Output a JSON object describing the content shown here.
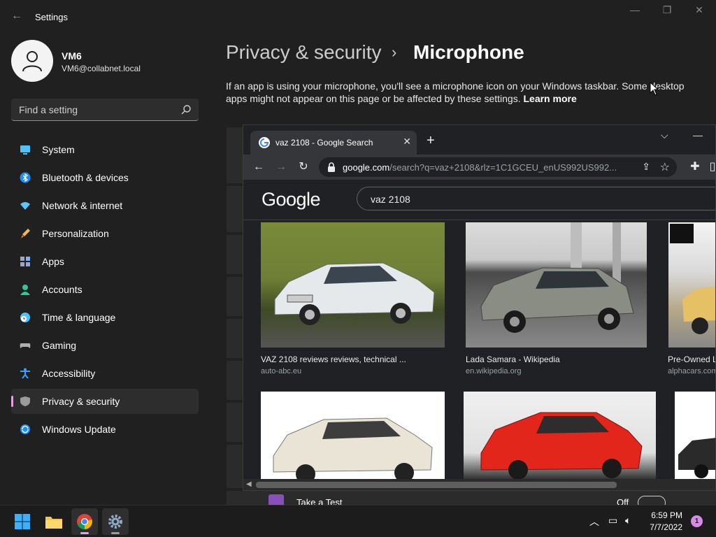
{
  "settings_window": {
    "title": "Settings",
    "user": {
      "name": "VM6",
      "email": "VM6@collabnet.local"
    },
    "search_placeholder": "Find a setting",
    "nav": [
      {
        "label": "System",
        "icon": "monitor-icon",
        "color": "#4cc2ff"
      },
      {
        "label": "Bluetooth & devices",
        "icon": "bluetooth-icon",
        "color": "#1f8ff0"
      },
      {
        "label": "Network & internet",
        "icon": "wifi-icon",
        "color": "#5ec6ff"
      },
      {
        "label": "Personalization",
        "icon": "brush-icon",
        "color": "#f7a34b"
      },
      {
        "label": "Apps",
        "icon": "apps-icon",
        "color": "#9aa7c7"
      },
      {
        "label": "Accounts",
        "icon": "person-icon",
        "color": "#35c49a"
      },
      {
        "label": "Time & language",
        "icon": "clock-globe-icon",
        "color": "#4cc2ff"
      },
      {
        "label": "Gaming",
        "icon": "gamepad-icon",
        "color": "#b0b0b0"
      },
      {
        "label": "Accessibility",
        "icon": "accessibility-icon",
        "color": "#3aa0ff"
      },
      {
        "label": "Privacy & security",
        "icon": "shield-icon",
        "color": "#9a9a9a",
        "active": true
      },
      {
        "label": "Windows Update",
        "icon": "update-icon",
        "color": "#1f8ff0"
      }
    ],
    "breadcrumb": {
      "parent": "Privacy & security",
      "separator": "›",
      "current": "Microphone"
    },
    "description": "If an app is using your microphone, you'll see a microphone icon on your Windows taskbar. Some desktop apps might not appear on this page or be affected by these settings.",
    "learn_more": "Learn more",
    "peek_row": {
      "label": "Take a Test",
      "state": "Off"
    }
  },
  "chrome": {
    "tab_title": "vaz 2108 - Google Search",
    "url_domain": "google.com",
    "url_path": "/search?q=vaz+2108&rlz=1C1GCEU_enUS992US992...",
    "logo": "Google",
    "query": "vaz 2108",
    "results": [
      {
        "title": "VAZ 2108 reviews reviews, technical ...",
        "source": "auto-abc.eu"
      },
      {
        "title": "Lada Samara - Wikipedia",
        "source": "en.wikipedia.org"
      },
      {
        "title": "Pre-Owned L",
        "source": "alphacars.com"
      }
    ]
  },
  "taskbar": {
    "time": "6:59 PM",
    "date": "7/7/2022",
    "notifications": "1"
  },
  "colors": {
    "accent": "#e3a0e4",
    "settings_bg": "#202020",
    "chrome_bg": "#202124"
  }
}
